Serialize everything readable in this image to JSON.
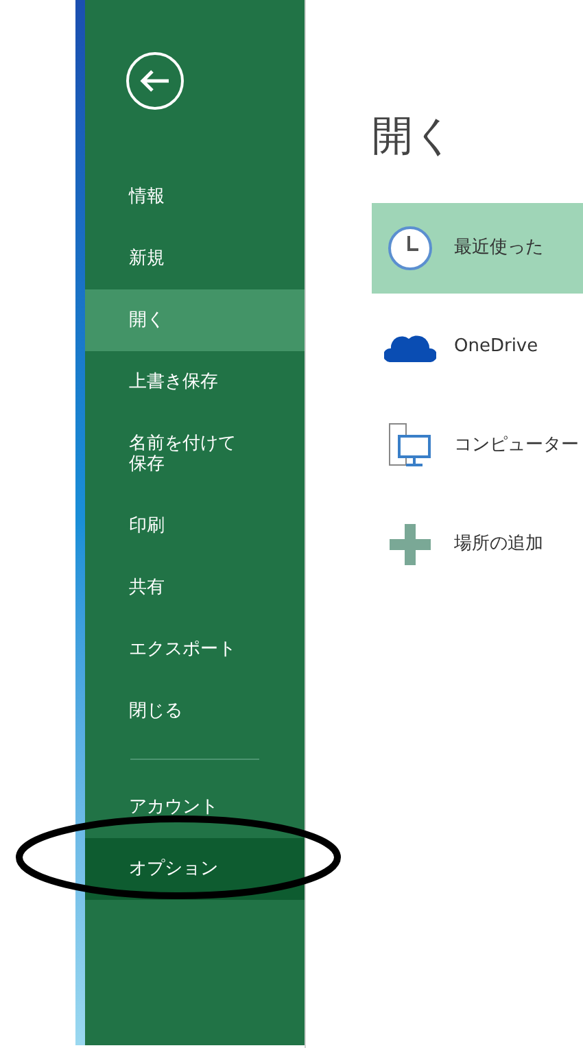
{
  "sidebar": {
    "items": [
      {
        "kind": "item",
        "label": "情報",
        "selected": false,
        "hovered": false
      },
      {
        "kind": "item",
        "label": "新規",
        "selected": false,
        "hovered": false
      },
      {
        "kind": "item",
        "label": "開く",
        "selected": true,
        "hovered": false
      },
      {
        "kind": "item",
        "label": "上書き保存",
        "selected": false,
        "hovered": false
      },
      {
        "kind": "item",
        "label": "名前を付けて保存",
        "selected": false,
        "hovered": false
      },
      {
        "kind": "item",
        "label": "印刷",
        "selected": false,
        "hovered": false
      },
      {
        "kind": "item",
        "label": "共有",
        "selected": false,
        "hovered": false
      },
      {
        "kind": "item",
        "label": "エクスポート",
        "selected": false,
        "hovered": false
      },
      {
        "kind": "item",
        "label": "閉じる",
        "selected": false,
        "hovered": false
      },
      {
        "kind": "divider"
      },
      {
        "kind": "item",
        "label": "アカウント",
        "selected": false,
        "hovered": false
      },
      {
        "kind": "item",
        "label": "オプション",
        "selected": false,
        "hovered": true
      }
    ]
  },
  "main": {
    "title": "開く",
    "places": [
      {
        "kind": "recent",
        "label": "最近使った",
        "selected": true
      },
      {
        "kind": "cloud",
        "label": "OneDrive",
        "selected": false
      },
      {
        "kind": "computer",
        "label": "コンピューター",
        "selected": false
      },
      {
        "kind": "add",
        "label": "場所の追加",
        "selected": false
      }
    ]
  }
}
